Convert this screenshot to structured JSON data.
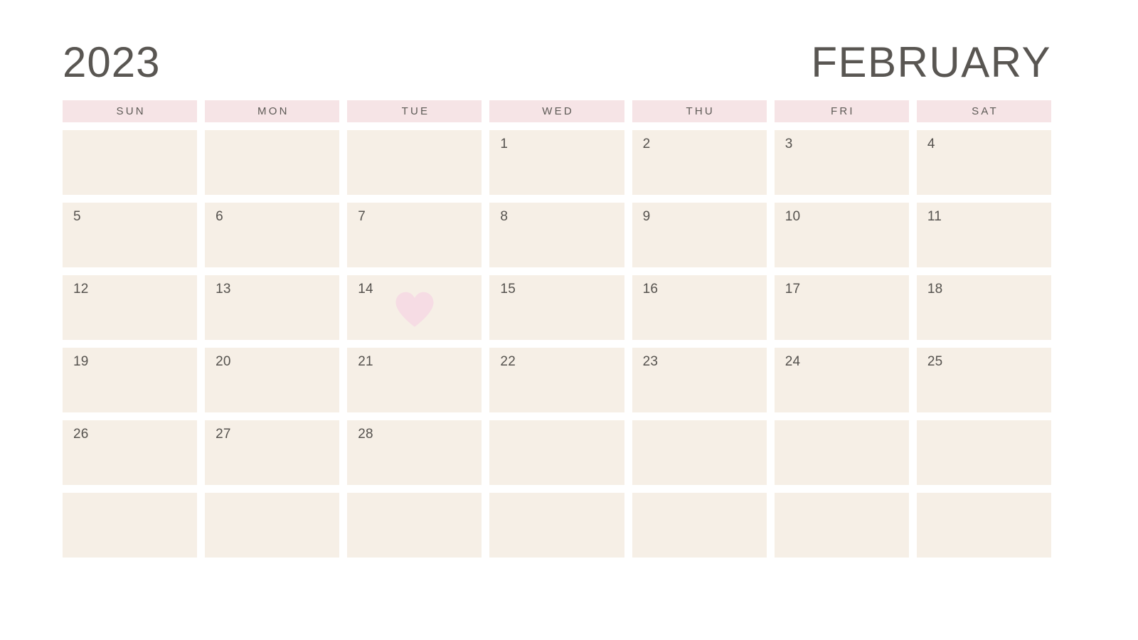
{
  "header": {
    "year": "2023",
    "month": "FEBRUARY"
  },
  "weekdays": [
    {
      "label": "SUN"
    },
    {
      "label": "MON"
    },
    {
      "label": "TUE"
    },
    {
      "label": "WED"
    },
    {
      "label": "THU"
    },
    {
      "label": "FRI"
    },
    {
      "label": "SAT"
    }
  ],
  "colors": {
    "page_background": "#ffffff",
    "weekday_header_background": "#f6e4e6",
    "day_cell_background": "#f6efe6",
    "text_dark": "#595652",
    "day_number": "#55524e",
    "heart_pink": "#f6dce4"
  },
  "weeks": [
    {
      "days": [
        {
          "date": "",
          "blank": true,
          "marker": ""
        },
        {
          "date": "",
          "blank": true,
          "marker": ""
        },
        {
          "date": "",
          "blank": true,
          "marker": ""
        },
        {
          "date": "1",
          "blank": false,
          "marker": ""
        },
        {
          "date": "2",
          "blank": false,
          "marker": ""
        },
        {
          "date": "3",
          "blank": false,
          "marker": ""
        },
        {
          "date": "4",
          "blank": false,
          "marker": ""
        }
      ]
    },
    {
      "days": [
        {
          "date": "5",
          "blank": false,
          "marker": ""
        },
        {
          "date": "6",
          "blank": false,
          "marker": ""
        },
        {
          "date": "7",
          "blank": false,
          "marker": ""
        },
        {
          "date": "8",
          "blank": false,
          "marker": ""
        },
        {
          "date": "9",
          "blank": false,
          "marker": ""
        },
        {
          "date": "10",
          "blank": false,
          "marker": ""
        },
        {
          "date": "11",
          "blank": false,
          "marker": ""
        }
      ]
    },
    {
      "days": [
        {
          "date": "12",
          "blank": false,
          "marker": ""
        },
        {
          "date": "13",
          "blank": false,
          "marker": ""
        },
        {
          "date": "14",
          "blank": false,
          "marker": "heart-icon"
        },
        {
          "date": "15",
          "blank": false,
          "marker": ""
        },
        {
          "date": "16",
          "blank": false,
          "marker": ""
        },
        {
          "date": "17",
          "blank": false,
          "marker": ""
        },
        {
          "date": "18",
          "blank": false,
          "marker": ""
        }
      ]
    },
    {
      "days": [
        {
          "date": "19",
          "blank": false,
          "marker": ""
        },
        {
          "date": "20",
          "blank": false,
          "marker": ""
        },
        {
          "date": "21",
          "blank": false,
          "marker": ""
        },
        {
          "date": "22",
          "blank": false,
          "marker": ""
        },
        {
          "date": "23",
          "blank": false,
          "marker": ""
        },
        {
          "date": "24",
          "blank": false,
          "marker": ""
        },
        {
          "date": "25",
          "blank": false,
          "marker": ""
        }
      ]
    },
    {
      "days": [
        {
          "date": "26",
          "blank": false,
          "marker": ""
        },
        {
          "date": "27",
          "blank": false,
          "marker": ""
        },
        {
          "date": "28",
          "blank": false,
          "marker": ""
        },
        {
          "date": "",
          "blank": true,
          "marker": ""
        },
        {
          "date": "",
          "blank": true,
          "marker": ""
        },
        {
          "date": "",
          "blank": true,
          "marker": ""
        },
        {
          "date": "",
          "blank": true,
          "marker": ""
        }
      ]
    },
    {
      "days": [
        {
          "date": "",
          "blank": true,
          "marker": ""
        },
        {
          "date": "",
          "blank": true,
          "marker": ""
        },
        {
          "date": "",
          "blank": true,
          "marker": ""
        },
        {
          "date": "",
          "blank": true,
          "marker": ""
        },
        {
          "date": "",
          "blank": true,
          "marker": ""
        },
        {
          "date": "",
          "blank": true,
          "marker": ""
        },
        {
          "date": "",
          "blank": true,
          "marker": ""
        }
      ]
    }
  ]
}
